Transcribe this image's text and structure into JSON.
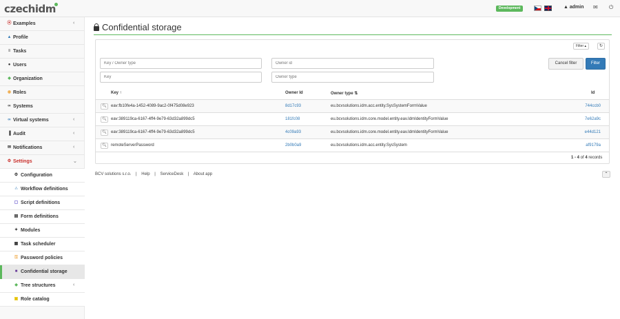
{
  "app": {
    "logo": "czechidm",
    "environment": "Development",
    "user": "admin"
  },
  "sidebar": {
    "items": [
      {
        "label": "Examples",
        "icon": "examples-icon",
        "glyph": "⦿"
      },
      {
        "label": "Profile",
        "icon": "user-icon",
        "glyph": "▲"
      },
      {
        "label": "Tasks",
        "icon": "list-icon",
        "glyph": "≡"
      },
      {
        "label": "Users",
        "icon": "users-icon",
        "glyph": "●"
      },
      {
        "label": "Organization",
        "icon": "tree-icon",
        "glyph": "◆"
      },
      {
        "label": "Roles",
        "icon": "roles-icon",
        "glyph": "◉"
      },
      {
        "label": "Systems",
        "icon": "link-icon",
        "glyph": "∞"
      },
      {
        "label": "Virtual systems",
        "icon": "link-icon",
        "glyph": "∞"
      },
      {
        "label": "Audit",
        "icon": "chart-icon",
        "glyph": "▐"
      },
      {
        "label": "Notifications",
        "icon": "envelope-icon",
        "glyph": "✉"
      },
      {
        "label": "Settings",
        "icon": "gear-icon",
        "glyph": "⚙"
      }
    ],
    "settings_children": [
      {
        "label": "Configuration",
        "icon": "gear-icon",
        "glyph": "⚙"
      },
      {
        "label": "Workflow definitions",
        "icon": "workflow-icon",
        "glyph": "∴"
      },
      {
        "label": "Script definitions",
        "icon": "script-icon",
        "glyph": "▢"
      },
      {
        "label": "Form definitions",
        "icon": "form-icon",
        "glyph": "▤"
      },
      {
        "label": "Modules",
        "icon": "puzzle-icon",
        "glyph": "✦"
      },
      {
        "label": "Task scheduler",
        "icon": "calendar-icon",
        "glyph": "▦"
      },
      {
        "label": "Password policies",
        "icon": "key-icon",
        "glyph": "⚿"
      },
      {
        "label": "Confidential storage",
        "icon": "lock-icon",
        "glyph": "■"
      },
      {
        "label": "Tree structures",
        "icon": "tree-icon",
        "glyph": "◆"
      },
      {
        "label": "Role catalog",
        "icon": "folder-icon",
        "glyph": "▣"
      }
    ]
  },
  "page": {
    "title": "Confidential storage"
  },
  "filter": {
    "toggle_label": "Filter ▴",
    "key_owner_type_placeholder": "Key / Owner type",
    "owner_id_placeholder": "Owner id",
    "key_placeholder": "Key",
    "owner_type_placeholder": "Owner type",
    "cancel_label": "Cancel filter",
    "apply_label": "Filter"
  },
  "table": {
    "columns": {
      "key": "Key ↑",
      "owner_id": "Owner Id",
      "owner_type": "Owner type ⇅",
      "id": "Id"
    },
    "rows": [
      {
        "key": "eav:fb10fe4a-1452-4089-9ac2-0f475d08e923",
        "owner_id": "8d17c93",
        "owner_type": "eu.bcvsolutions.idm.acc.entity.SysSystemFormValue",
        "id": "744ccb0"
      },
      {
        "key": "eav:389119ca-6167-4ff4-9e79-63d32a899dc5",
        "owner_id": "181fc08",
        "owner_type": "eu.bcvsolutions.idm.core.model.entity.eav.IdmIdentityFormValue",
        "id": "7e62a9c"
      },
      {
        "key": "eav:389119ca-6167-4ff4-9e79-63d32a899dc5",
        "owner_id": "4c09a93",
        "owner_type": "eu.bcvsolutions.idm.core.model.entity.eav.IdmIdentityFormValue",
        "id": "e44d121"
      },
      {
        "key": "remoteServerPassword",
        "owner_id": "2b0b0a9",
        "owner_type": "eu.bcvsolutions.idm.acc.entity.SysSystem",
        "id": "af9179a"
      }
    ],
    "records_prefix": "1 - 4",
    "records_of": " of ",
    "records_total": "4",
    "records_suffix": " records"
  },
  "footer": {
    "company": "BCV solutions s.r.o.",
    "separator": "|",
    "help": "Help",
    "servicedesk": "ServiceDesk",
    "about": "About app"
  }
}
